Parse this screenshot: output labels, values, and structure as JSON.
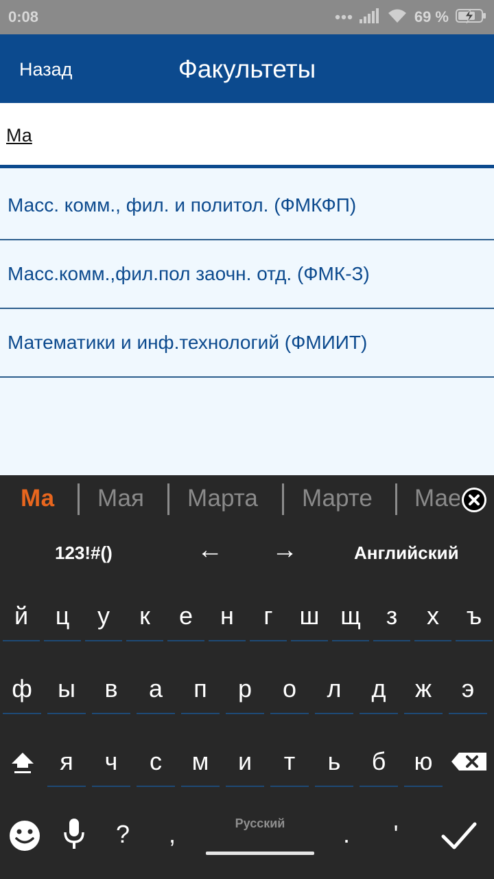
{
  "status_bar": {
    "time": "0:08",
    "battery_text": "69 %",
    "icons": [
      "dots-icon",
      "signal-icon",
      "wifi-icon",
      "battery-charging-icon"
    ]
  },
  "app_bar": {
    "back_label": "Назад",
    "title": "Факультеты"
  },
  "search": {
    "value": "Ма"
  },
  "results": [
    {
      "label": "Масс. комм., фил. и политол. (ФМКФП)"
    },
    {
      "label": "Масс.комм.,фил.пол заочн. отд. (ФМК-З)"
    },
    {
      "label": "Математики и инф.технологий (ФМИИТ)"
    }
  ],
  "keyboard": {
    "suggestions": [
      "Ма",
      "Мая",
      "Марта",
      "Марте",
      "Мае"
    ],
    "toolbar": {
      "symbols_label": "123!#()",
      "left_arrow": "←",
      "right_arrow": "→",
      "language_label": "Английский"
    },
    "rows": [
      [
        "й",
        "ц",
        "у",
        "к",
        "е",
        "н",
        "г",
        "ш",
        "щ",
        "з",
        "х",
        "ъ"
      ],
      [
        "ф",
        "ы",
        "в",
        "а",
        "п",
        "р",
        "о",
        "л",
        "д",
        "ж",
        "э"
      ],
      [
        "я",
        "ч",
        "с",
        "м",
        "и",
        "т",
        "ь",
        "б",
        "ю"
      ]
    ],
    "bottom": {
      "question": "?",
      "comma": ",",
      "space_label": "Русский",
      "period": ".",
      "apostrophe": "'"
    }
  },
  "colors": {
    "app_bar": "#0c4a8e",
    "list_background": "#f0f8fe",
    "keyboard_background": "#282828",
    "suggestion_active": "#e8661e",
    "status_bar": "#8a8a8a"
  }
}
